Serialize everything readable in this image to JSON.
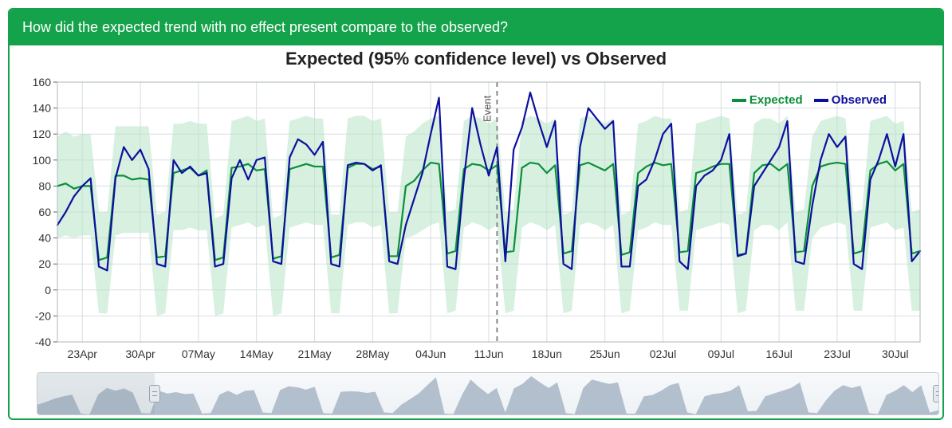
{
  "header": {
    "question": "How did the expected trend with no effect present compare to the observed?"
  },
  "chart": {
    "title": "Expected (95% confidence level) vs Observed",
    "legend": {
      "expected": "Expected",
      "observed": "Observed"
    },
    "event_label": "Event"
  },
  "axes": {
    "y_ticks": [
      -40,
      -20,
      0,
      20,
      40,
      60,
      80,
      100,
      120,
      140,
      160
    ],
    "x_ticks": [
      "23Apr",
      "30Apr",
      "07May",
      "14May",
      "21May",
      "28May",
      "04Jun",
      "11Jun",
      "18Jun",
      "25Jun",
      "02Jul",
      "09Jul",
      "16Jul",
      "23Jul",
      "30Jul"
    ]
  },
  "chart_data": {
    "type": "line",
    "x": [
      0,
      1,
      2,
      3,
      4,
      5,
      6,
      7,
      8,
      9,
      10,
      11,
      12,
      13,
      14,
      15,
      16,
      17,
      18,
      19,
      20,
      21,
      22,
      23,
      24,
      25,
      26,
      27,
      28,
      29,
      30,
      31,
      32,
      33,
      34,
      35,
      36,
      37,
      38,
      39,
      40,
      41,
      42,
      43,
      44,
      45,
      46,
      47,
      48,
      49,
      50,
      51,
      52,
      53,
      54,
      55,
      56,
      57,
      58,
      59,
      60,
      61,
      62,
      63,
      64,
      65,
      66,
      67,
      68,
      69,
      70,
      71,
      72,
      73,
      74,
      75,
      76,
      77,
      78,
      79,
      80,
      81,
      82,
      83,
      84,
      85,
      86,
      87,
      88,
      89,
      90,
      91,
      92,
      93,
      94,
      95,
      96,
      97,
      98,
      99,
      100,
      101,
      102,
      103,
      104
    ],
    "x_categories": [
      "23Apr",
      "30Apr",
      "07May",
      "14May",
      "21May",
      "28May",
      "04Jun",
      "11Jun",
      "18Jun",
      "25Jun",
      "02Jul",
      "09Jul",
      "16Jul",
      "23Jul",
      "30Jul"
    ],
    "ylim": [
      -40,
      160
    ],
    "xlabel": "",
    "ylabel": "",
    "event_x": 53,
    "series": [
      {
        "name": "Expected",
        "color": "#0b8f3a",
        "values": [
          80,
          82,
          78,
          80,
          80,
          23,
          25,
          88,
          88,
          85,
          86,
          85,
          25,
          26,
          90,
          92,
          94,
          88,
          92,
          23,
          25,
          94,
          95,
          97,
          92,
          93,
          24,
          26,
          93,
          95,
          97,
          95,
          95,
          25,
          27,
          94,
          97,
          97,
          93,
          95,
          26,
          26,
          80,
          84,
          92,
          98,
          97,
          28,
          30,
          93,
          97,
          96,
          92,
          96,
          29,
          30,
          94,
          98,
          97,
          90,
          96,
          28,
          30,
          96,
          98,
          95,
          92,
          97,
          27,
          29,
          90,
          95,
          98,
          96,
          97,
          29,
          30,
          90,
          92,
          95,
          97,
          97,
          27,
          28,
          90,
          96,
          97,
          92,
          97,
          29,
          30,
          80,
          95,
          97,
          98,
          97,
          28,
          30,
          92,
          97,
          99,
          92,
          97,
          28,
          30
        ]
      },
      {
        "name": "Observed",
        "color": "#0d0f9e",
        "values": [
          50,
          60,
          72,
          80,
          86,
          18,
          15,
          86,
          110,
          100,
          108,
          93,
          20,
          18,
          100,
          90,
          95,
          88,
          90,
          18,
          20,
          86,
          100,
          85,
          100,
          102,
          22,
          20,
          102,
          116,
          112,
          104,
          114,
          20,
          18,
          96,
          98,
          97,
          92,
          96,
          22,
          20,
          50,
          70,
          90,
          120,
          148,
          18,
          16,
          85,
          140,
          112,
          88,
          110,
          22,
          108,
          125,
          152,
          130,
          110,
          130,
          20,
          16,
          110,
          140,
          132,
          124,
          130,
          18,
          18,
          80,
          85,
          100,
          120,
          128,
          22,
          16,
          80,
          88,
          92,
          100,
          120,
          26,
          28,
          80,
          90,
          100,
          110,
          130,
          22,
          20,
          65,
          100,
          120,
          110,
          118,
          20,
          16,
          85,
          100,
          120,
          95,
          120,
          22,
          30
        ]
      }
    ],
    "band": {
      "name": "95% CI of Expected",
      "color": "#b7e4c7",
      "upper": [
        118,
        122,
        118,
        120,
        120,
        60,
        60,
        126,
        126,
        126,
        126,
        126,
        58,
        60,
        128,
        128,
        130,
        128,
        128,
        55,
        58,
        130,
        132,
        134,
        130,
        132,
        55,
        58,
        130,
        132,
        134,
        132,
        132,
        58,
        58,
        132,
        134,
        134,
        130,
        132,
        60,
        60,
        118,
        122,
        128,
        132,
        134,
        60,
        62,
        130,
        134,
        132,
        128,
        132,
        60,
        62,
        130,
        134,
        132,
        128,
        132,
        58,
        60,
        132,
        134,
        132,
        128,
        132,
        58,
        60,
        128,
        130,
        134,
        132,
        132,
        60,
        62,
        128,
        130,
        132,
        134,
        132,
        58,
        60,
        128,
        132,
        132,
        128,
        134,
        60,
        62,
        118,
        130,
        132,
        134,
        132,
        60,
        62,
        130,
        132,
        134,
        128,
        130,
        60,
        62
      ],
      "lower": [
        40,
        42,
        40,
        42,
        42,
        -18,
        -18,
        42,
        44,
        44,
        44,
        44,
        -20,
        -18,
        46,
        46,
        48,
        46,
        46,
        -20,
        -18,
        48,
        50,
        52,
        48,
        50,
        -20,
        -18,
        48,
        50,
        52,
        50,
        50,
        -18,
        -18,
        50,
        52,
        52,
        48,
        50,
        -18,
        -18,
        40,
        42,
        46,
        50,
        52,
        -18,
        -16,
        48,
        52,
        50,
        46,
        50,
        -18,
        -16,
        48,
        52,
        50,
        46,
        50,
        -18,
        -16,
        50,
        52,
        50,
        46,
        50,
        -18,
        -16,
        46,
        48,
        52,
        50,
        50,
        -16,
        -16,
        46,
        48,
        50,
        52,
        50,
        -18,
        -16,
        46,
        50,
        50,
        46,
        52,
        -16,
        -16,
        40,
        48,
        50,
        52,
        50,
        -16,
        -16,
        48,
        50,
        52,
        46,
        48,
        -16,
        -16
      ]
    }
  },
  "range_selector": {
    "left_pct": 13,
    "right_pct": 100
  }
}
